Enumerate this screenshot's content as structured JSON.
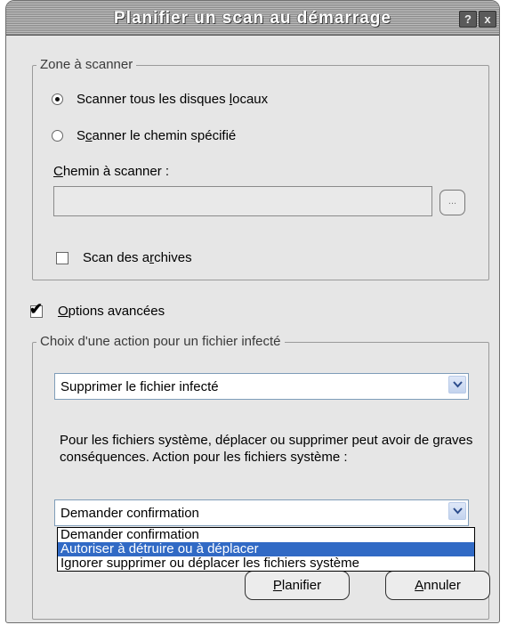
{
  "window": {
    "title": "Planifier un scan au démarrage",
    "help_glyph": "?",
    "close_glyph": "x"
  },
  "zone": {
    "legend": "Zone à scanner",
    "radio_all_label": "Scanner tous les disques locaux",
    "radio_path_label": "Scanner le chemin spécifié",
    "radio_all_selected": true,
    "path_label": "Chemin à scanner :",
    "path_value": "",
    "browse_label": "...",
    "archives_label": "Scan des archives",
    "archives_checked": false
  },
  "advanced": {
    "label": "Options avancées",
    "checked": true
  },
  "action": {
    "legend": "Choix d'une action pour un fichier infecté",
    "infected_value": "Supprimer le fichier infecté",
    "system_description": "Pour les fichiers système, déplacer ou supprimer peut avoir de graves conséquences. Action pour les fichiers système :",
    "system_value": "Demander confirmation",
    "system_options": [
      "Demander confirmation",
      "Autoriser à détruire ou à déplacer",
      "Ignorer supprimer ou déplacer les fichiers système"
    ],
    "system_highlighted_index": 1
  },
  "buttons": {
    "schedule": "Planifier",
    "cancel": "Annuler"
  },
  "colors": {
    "highlight": "#316ac5",
    "dialog_bg": "#e6e6e6"
  }
}
